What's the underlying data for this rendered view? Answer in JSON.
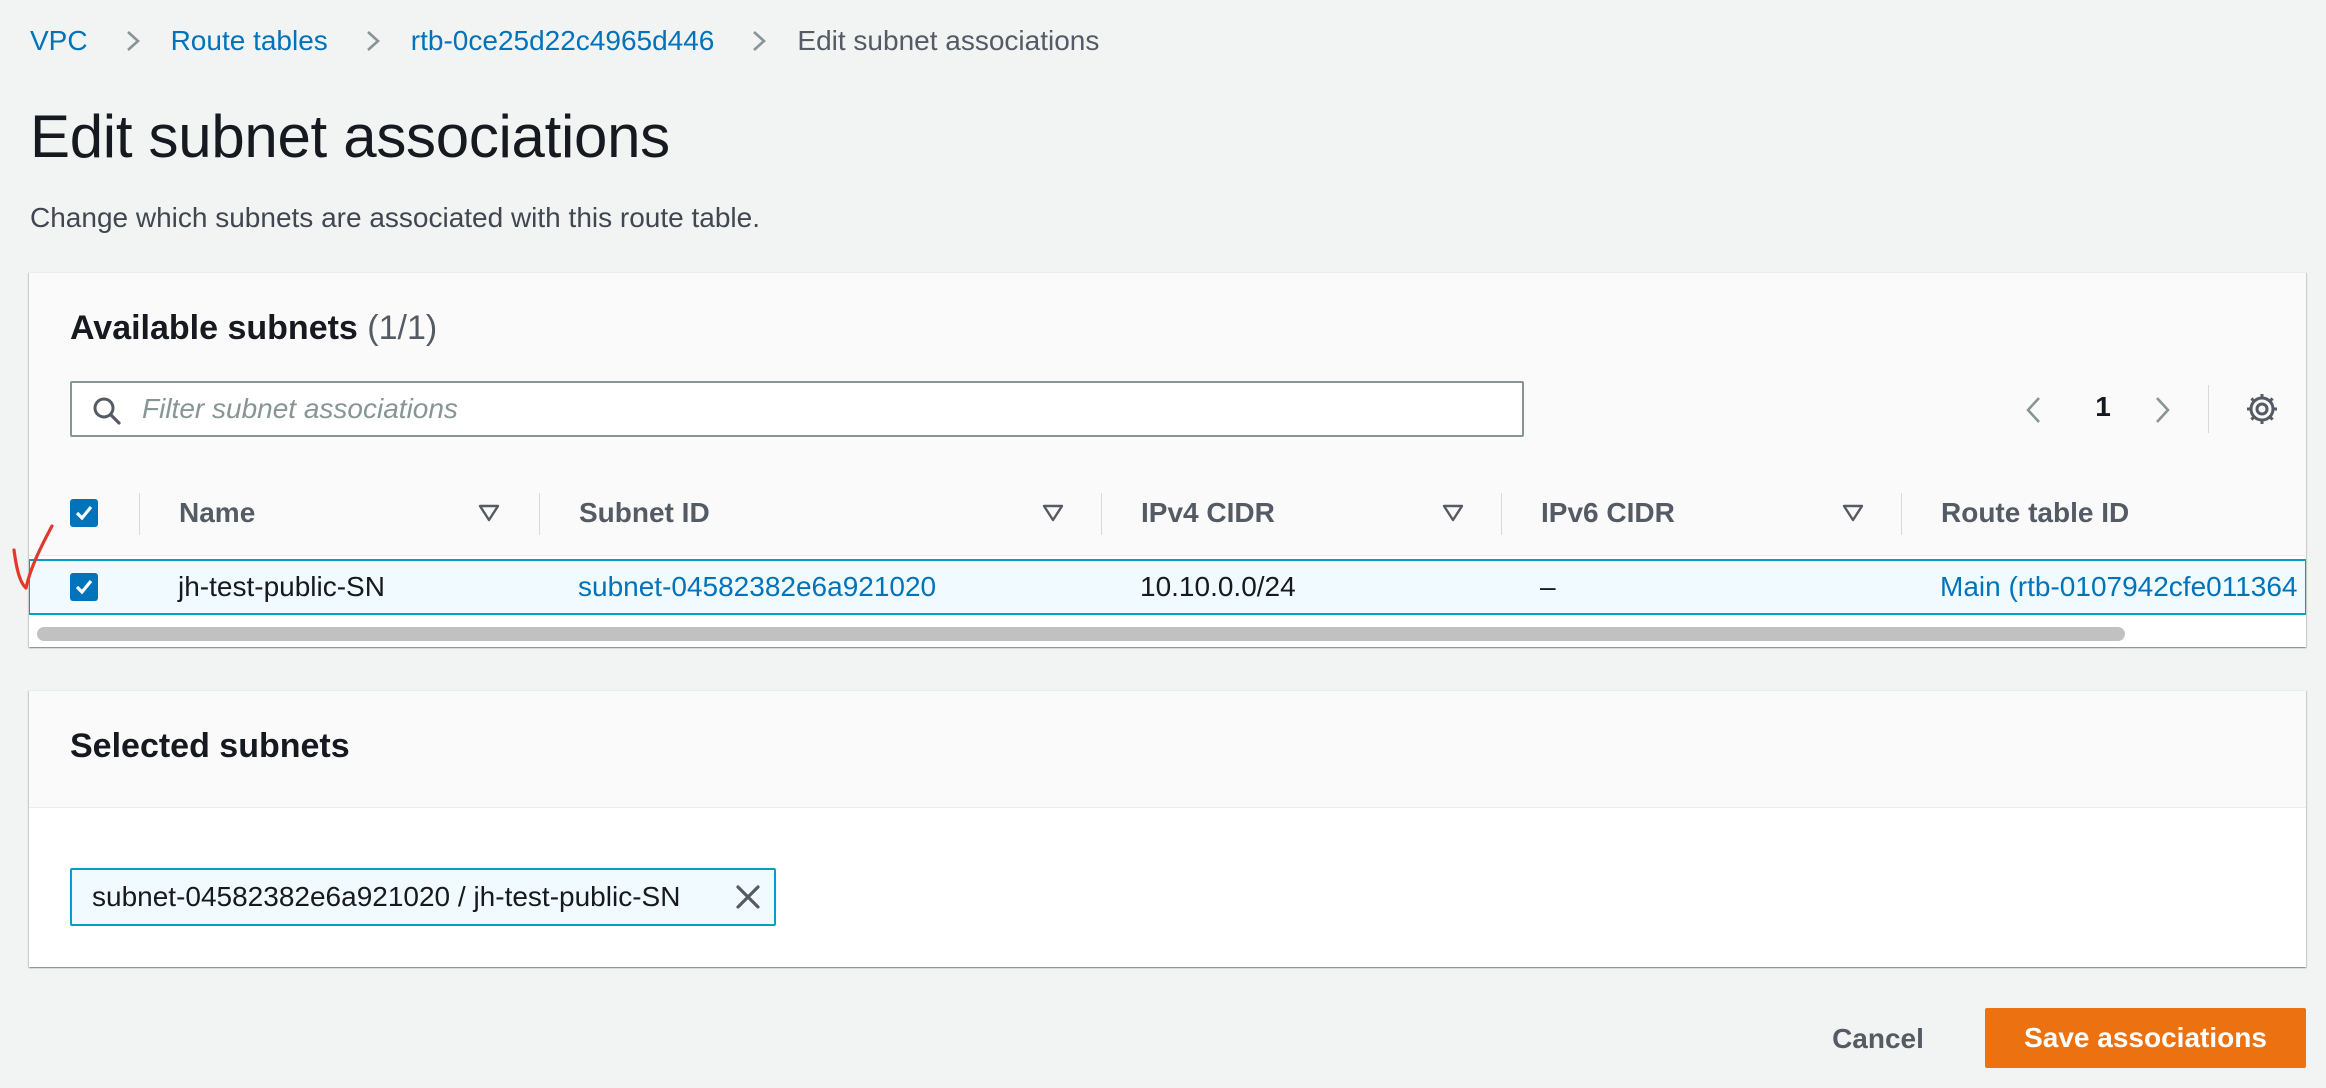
{
  "breadcrumb": {
    "items": [
      "VPC",
      "Route tables",
      "rtb-0ce25d22c4965d446"
    ],
    "current": "Edit subnet associations"
  },
  "page": {
    "title": "Edit subnet associations",
    "description": "Change which subnets are associated with this route table."
  },
  "available": {
    "title": "Available subnets",
    "count": "(1/1)",
    "filter_placeholder": "Filter subnet associations",
    "filter_value": "",
    "pagination": {
      "current_page": "1"
    },
    "columns": [
      "Name",
      "Subnet ID",
      "IPv4 CIDR",
      "IPv6 CIDR",
      "Route table ID"
    ],
    "select_all_checked": true,
    "rows": [
      {
        "checked": true,
        "name": "jh-test-public-SN",
        "subnet_id": "subnet-04582382e6a921020",
        "ipv4_cidr": "10.10.0.0/24",
        "ipv6_cidr": "–",
        "route_table_id": "Main (rtb-0107942cfe011364"
      }
    ]
  },
  "selected": {
    "title": "Selected subnets",
    "tokens": [
      "subnet-04582382e6a921020 / jh-test-public-SN"
    ]
  },
  "footer": {
    "cancel_label": "Cancel",
    "save_label": "Save associations"
  },
  "colors": {
    "link": "#0073bb",
    "primary_button": "#ec7211",
    "selection_border": "#00a1c9",
    "selection_bg": "#f1faff",
    "annotation": "#e0392b"
  },
  "icons": {
    "breadcrumb_separator": "chevron-right-icon",
    "filter": "search-icon",
    "prev_page": "chevron-left-icon",
    "next_page": "chevron-right-icon",
    "preferences": "gear-icon",
    "sort": "sort-down-icon",
    "remove_token": "close-icon",
    "checkbox": "checkmark-icon"
  }
}
